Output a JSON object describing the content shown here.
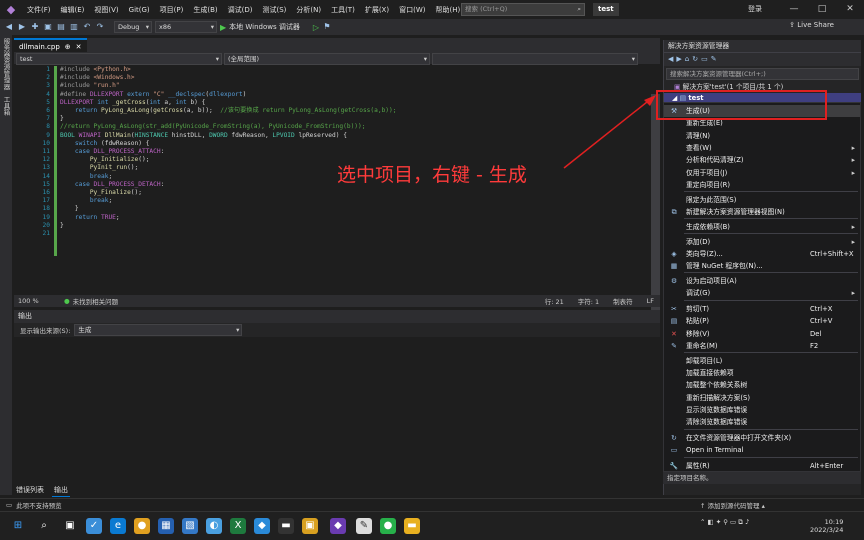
{
  "menu": {
    "items": [
      "文件(F)",
      "编辑(E)",
      "视图(V)",
      "Git(G)",
      "项目(P)",
      "生成(B)",
      "调试(D)",
      "测试(S)",
      "分析(N)",
      "工具(T)",
      "扩展(X)",
      "窗口(W)",
      "帮助(H)"
    ],
    "search_placeholder": "搜索 (Ctrl+Q)",
    "solution_name": "test",
    "login": "登录"
  },
  "toolbar": {
    "config": "Debug",
    "platform": "x86",
    "run_label": "本地 Windows 调试器",
    "live_share": "Live Share"
  },
  "left_tabs": [
    "服务器资源管理器",
    "工具箱"
  ],
  "editor": {
    "tab_name": "dllmain.cpp",
    "nav_project": "test",
    "nav_scope": "(全局范围)",
    "line_numbers": [
      "1",
      "2",
      "3",
      "4",
      "5",
      "6",
      "7",
      "8",
      "9",
      "10",
      "11",
      "12",
      "13",
      "14",
      "15",
      "16",
      "17",
      "18",
      "19",
      "20",
      "21"
    ],
    "zoom": "100 %",
    "issues": "未找到相关问题",
    "line": "行: 21",
    "char": "字符: 1",
    "tabs": "制表符",
    "eol": "LF"
  },
  "output": {
    "title": "输出",
    "source_label": "显示输出来源(S):",
    "source_value": "生成"
  },
  "bottom_tabs": [
    "错误列表",
    "输出"
  ],
  "status": {
    "left": "此项不支持预览",
    "right": "添加到源代码管理"
  },
  "taskbar": {
    "time": "10:19",
    "date": "2022/3/24"
  },
  "solution_explorer": {
    "title": "解决方案资源管理器",
    "search_placeholder": "搜索解决方案资源管理器(Ctrl+;)",
    "solution_line": "解决方案'test'(1 个项目/共 1 个)",
    "project": "test",
    "footer": "指定项目名称。"
  },
  "context_menu": [
    {
      "label": "生成(U)",
      "shortcut": "",
      "arrow": false,
      "icon": "build-icon"
    },
    {
      "label": "重新生成(E)",
      "shortcut": "",
      "arrow": false,
      "icon": ""
    },
    {
      "label": "清理(N)",
      "shortcut": "",
      "arrow": false,
      "icon": ""
    },
    {
      "label": "查看(W)",
      "shortcut": "",
      "arrow": true,
      "icon": ""
    },
    {
      "label": "分析和代码清理(Z)",
      "shortcut": "",
      "arrow": true,
      "icon": ""
    },
    {
      "label": "仅用于项目(J)",
      "shortcut": "",
      "arrow": true,
      "icon": ""
    },
    {
      "label": "重定向项目(R)",
      "shortcut": "",
      "arrow": false,
      "icon": ""
    },
    {
      "label": "限定为此范围(S)",
      "shortcut": "",
      "arrow": false,
      "icon": ""
    },
    {
      "label": "新建解决方案资源管理器视图(N)",
      "shortcut": "",
      "arrow": false,
      "icon": "new-view-icon"
    },
    {
      "label": "生成依赖项(B)",
      "shortcut": "",
      "arrow": true,
      "icon": ""
    },
    {
      "label": "添加(D)",
      "shortcut": "",
      "arrow": true,
      "icon": ""
    },
    {
      "label": "类向导(Z)...",
      "shortcut": "Ctrl+Shift+X",
      "arrow": false,
      "icon": "class-wizard-icon"
    },
    {
      "label": "管理 NuGet 程序包(N)...",
      "shortcut": "",
      "arrow": false,
      "icon": "nuget-icon"
    },
    {
      "label": "设为启动项目(A)",
      "shortcut": "",
      "arrow": false,
      "icon": "gear-icon"
    },
    {
      "label": "调试(G)",
      "shortcut": "",
      "arrow": true,
      "icon": ""
    },
    {
      "label": "剪切(T)",
      "shortcut": "Ctrl+X",
      "arrow": false,
      "icon": "cut-icon"
    },
    {
      "label": "粘贴(P)",
      "shortcut": "Ctrl+V",
      "arrow": false,
      "icon": "paste-icon"
    },
    {
      "label": "移除(V)",
      "shortcut": "Del",
      "arrow": false,
      "icon": "remove-icon"
    },
    {
      "label": "重命名(M)",
      "shortcut": "F2",
      "arrow": false,
      "icon": "rename-icon"
    },
    {
      "label": "卸载项目(L)",
      "shortcut": "",
      "arrow": false,
      "icon": ""
    },
    {
      "label": "加载直接依赖项",
      "shortcut": "",
      "arrow": false,
      "icon": ""
    },
    {
      "label": "加载整个依赖关系树",
      "shortcut": "",
      "arrow": false,
      "icon": ""
    },
    {
      "label": "重新扫描解决方案(S)",
      "shortcut": "",
      "arrow": false,
      "icon": ""
    },
    {
      "label": "显示浏览数据库错误",
      "shortcut": "",
      "arrow": false,
      "icon": ""
    },
    {
      "label": "清除浏览数据库错误",
      "shortcut": "",
      "arrow": false,
      "icon": ""
    },
    {
      "label": "在文件资源管理器中打开文件夹(X)",
      "shortcut": "",
      "arrow": false,
      "icon": "open-folder-icon"
    },
    {
      "label": "Open in Terminal",
      "shortcut": "",
      "arrow": false,
      "icon": "terminal-icon"
    },
    {
      "label": "属性(R)",
      "shortcut": "Alt+Enter",
      "arrow": false,
      "icon": "properties-icon"
    }
  ],
  "annotation": "选中项目，右键 - 生成"
}
